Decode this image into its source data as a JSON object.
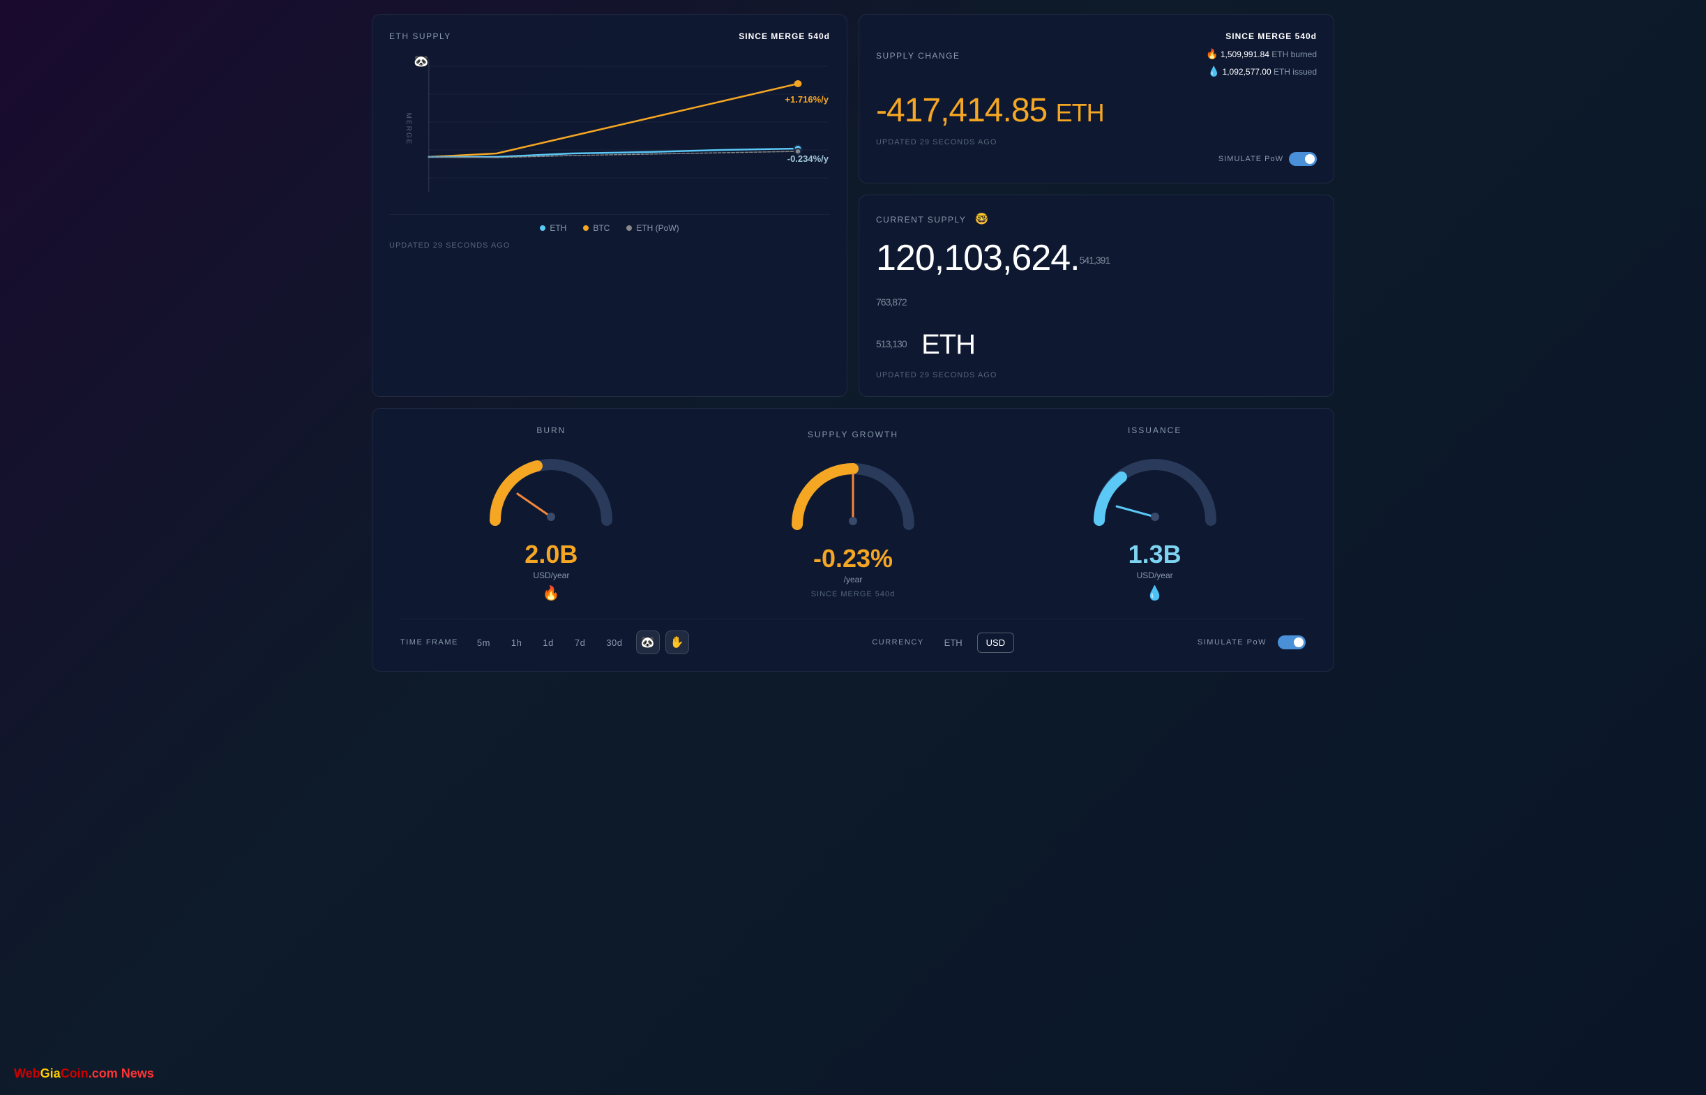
{
  "eth_supply_card": {
    "title": "ETH SUPPLY",
    "since_merge_label": "SINCE MERGE",
    "since_merge_value": "540d",
    "rate_btc": "+1.716%/y",
    "rate_eth": "-0.234%/y",
    "updated": "UPDATED 29 SECONDS AGO",
    "legend": [
      {
        "label": "ETH",
        "color": "#5bc8f5"
      },
      {
        "label": "BTC",
        "color": "#f5a623"
      },
      {
        "label": "ETH (PoW)",
        "color": "#888888"
      }
    ],
    "merge_label": "MERGE"
  },
  "supply_change_card": {
    "title": "SUPPLY CHANGE",
    "since_merge_label": "SINCE MERGE",
    "since_merge_value": "540d",
    "value": "-417,414.85",
    "unit": "ETH",
    "updated": "UPDATED 29 SECONDS AGO",
    "burned_label": "ETH burned",
    "burned_value": "1,509,991.84",
    "issued_label": "ETH issued",
    "issued_value": "1,092,577.00",
    "simulate_pow_label": "SIMULATE PoW"
  },
  "current_supply_card": {
    "title": "CURRENT SUPPLY",
    "value": "120,103,624.",
    "decimals": "541,391\n763,872\n513,130",
    "decimals_display": "541,391 763,872 513,130",
    "unit": "ETH",
    "updated": "UPDATED 29 SECONDS AGO"
  },
  "burn_gauge": {
    "title": "BURN",
    "value": "2.0B",
    "unit": "USD/year",
    "icon": "🔥",
    "needle_angle": -30
  },
  "supply_growth_gauge": {
    "title": "SUPPLY GROWTH",
    "value": "-0.23%",
    "unit": "/year",
    "since_merge_label": "SINCE MERGE",
    "since_merge_value": "540d",
    "needle_angle": 0
  },
  "issuance_gauge": {
    "title": "ISSUANCE",
    "value": "1.3B",
    "unit": "USD/year",
    "icon": "💧",
    "needle_angle": -60
  },
  "bottom_controls": {
    "timeframe_label": "TIME FRAME",
    "timeframe_options": [
      "5m",
      "1h",
      "1d",
      "7d",
      "30d"
    ],
    "currency_label": "CURRENCY",
    "currency_options": [
      "ETH",
      "USD"
    ],
    "currency_active": "USD",
    "simulate_pow_label": "SIMULATE PoW"
  },
  "watermark": {
    "web": "Web",
    "gia": "Gia",
    "coin": "Coin",
    "rest": ".com News"
  }
}
